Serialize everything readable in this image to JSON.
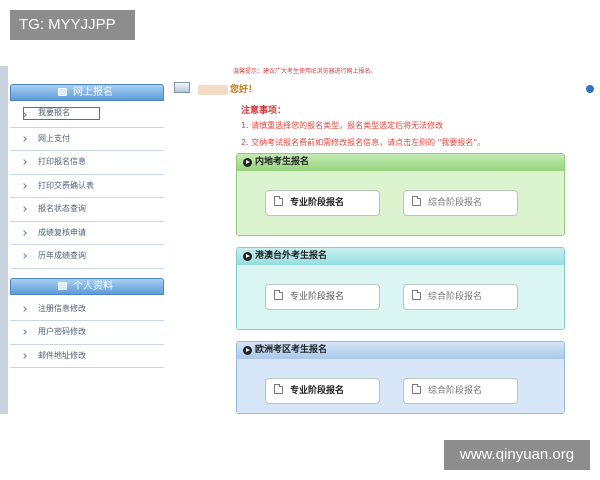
{
  "watermark_top": "TG: MYYJJPP",
  "watermark_bottom": "www.qinyuan.org",
  "header": {
    "greeting_suffix": "您好！",
    "top_notice": "温馨提示：建议广大考生使用IE浏览器进行网上报名。"
  },
  "sidebar": {
    "online_reg": {
      "title": "网上报名",
      "items": [
        {
          "label": "我要报名",
          "selected": true
        },
        {
          "label": "网上支付"
        },
        {
          "label": "打印报名信息"
        },
        {
          "label": "打印交费确认表"
        },
        {
          "label": "报名状态查询"
        },
        {
          "label": "成绩复核申请"
        },
        {
          "label": "历年成绩查询"
        }
      ]
    },
    "personal": {
      "title": "个人资料",
      "items": [
        {
          "label": "注册信息修改"
        },
        {
          "label": "用户密码修改"
        },
        {
          "label": "邮件地址修改"
        }
      ]
    }
  },
  "notice": {
    "title": "注意事项：",
    "lines": [
      "1. 请慎重选择您的报名类型，报名类型选定后将无法修改",
      "2. 交纳考试报名费前如需修改报名信息，请点击左侧的 \"我要报名\"。"
    ]
  },
  "panels": [
    {
      "title": "内地考生报名",
      "buttons": [
        "专业阶段报名",
        "综合阶段报名"
      ],
      "color": "#97d57e"
    },
    {
      "title": "港澳台外考生报名",
      "buttons": [
        "专业阶段报名",
        "综合阶段报名"
      ],
      "color": "#95dddf"
    },
    {
      "title": "欧洲考区考生报名",
      "buttons": [
        "专业阶段报名",
        "综合阶段报名"
      ],
      "color": "#a9c7ea"
    }
  ]
}
